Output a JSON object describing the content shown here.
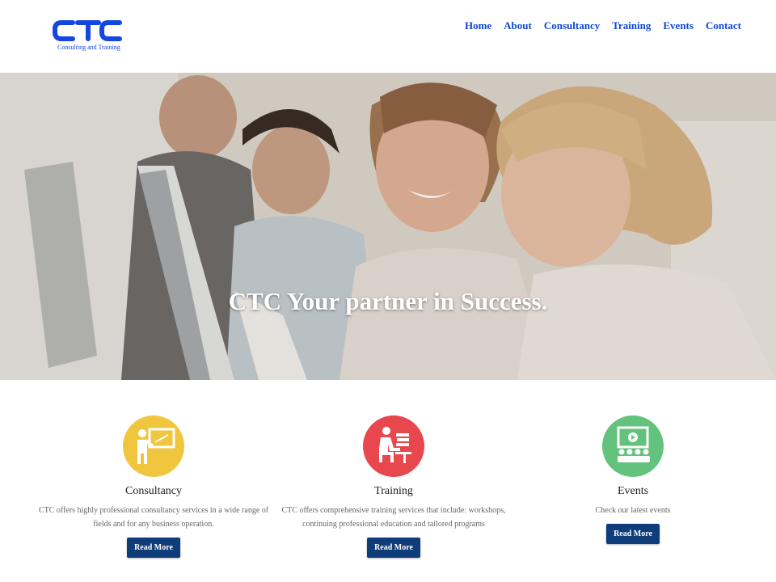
{
  "brand": {
    "logo_text": "CTC",
    "tagline": "Consulting and Training",
    "color": "#1546e0"
  },
  "nav": {
    "items": [
      "Home",
      "About",
      "Consultancy",
      "Training",
      "Events",
      "Contact"
    ]
  },
  "hero": {
    "title": "CTC Your partner in Success."
  },
  "features": [
    {
      "title": "Consultancy",
      "description": "CTC offers highly professional consultancy services in a wide range of fields and for any business operation.",
      "button": "Read More",
      "icon": "teacher-board-icon",
      "color": "#f0c63f"
    },
    {
      "title": "Training",
      "description": "CTC offers comprehensive training services that include: workshops, continuing professional education and tailored programs",
      "button": "Read More",
      "icon": "student-desk-icon",
      "color": "#e8474d"
    },
    {
      "title": "Events",
      "description": "Check our latest events",
      "button": "Read More",
      "icon": "presentation-audience-icon",
      "color": "#63c27b"
    }
  ]
}
